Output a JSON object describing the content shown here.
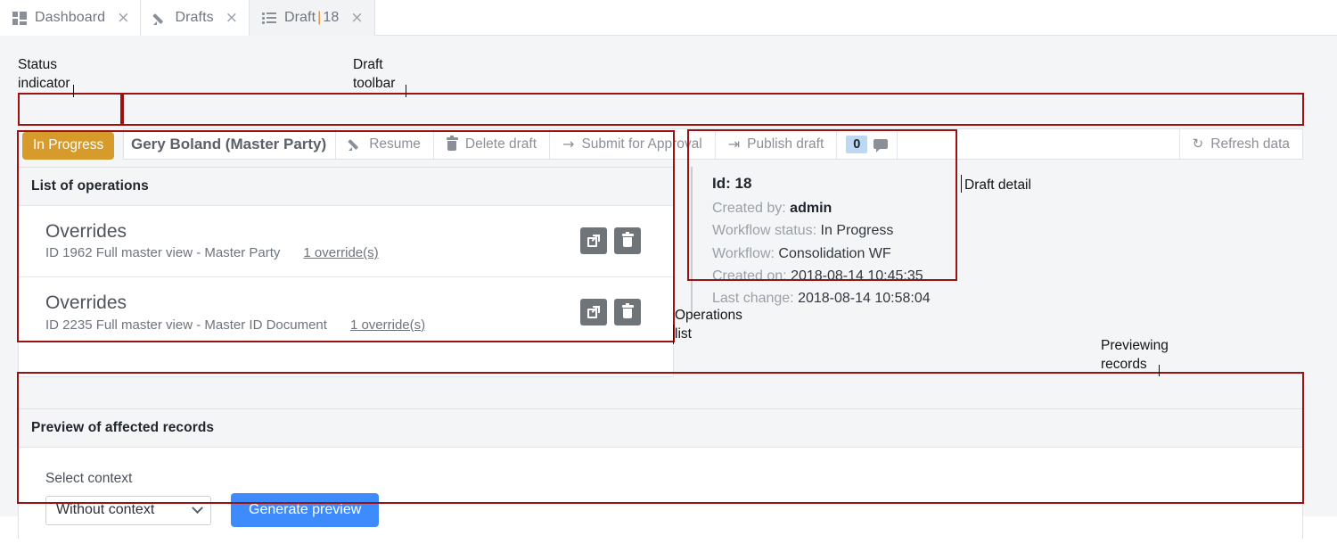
{
  "tabs": [
    {
      "label": "Dashboard",
      "icon": "dashboard-grid-icon",
      "close": "×",
      "active": false
    },
    {
      "label": "Drafts",
      "icon": "pencil-icon",
      "close": "×",
      "active": false
    },
    {
      "label": "Draft | 18",
      "label_main": "Draft",
      "label_sep": "|",
      "label_id": "18",
      "icon": "list-icon",
      "close": "×",
      "active": true
    }
  ],
  "toolbar": {
    "status_badge": "In Progress",
    "title": "Gery Boland (Master Party)",
    "resume_label": "Resume",
    "delete_label": "Delete draft",
    "submit_label": "Submit for Approval",
    "publish_label": "Publish draft",
    "comment_count": "0",
    "refresh_label": "Refresh data",
    "icons": {
      "resume": "pencil-icon",
      "delete": "trash-icon",
      "submit": "arrow-right-icon",
      "publish": "arrow-to-bar-icon",
      "comment": "speech-bubble-icon",
      "refresh": "refresh-icon"
    },
    "submit_arrow": "→",
    "publish_arrow": "⇥",
    "refresh_arrow": "↻"
  },
  "operations": {
    "header": "List of operations",
    "rows": [
      {
        "title": "Overrides",
        "subtitle": "ID 1962 Full master view - Master Party",
        "link": "1 override(s)",
        "open_icon": "external-link-icon",
        "delete_icon": "trash-icon"
      },
      {
        "title": "Overrides",
        "subtitle": "ID 2235 Full master view - Master ID Document",
        "link": "1 override(s)",
        "open_icon": "external-link-icon",
        "delete_icon": "trash-icon"
      }
    ]
  },
  "detail": {
    "id_label": "Id:",
    "id_value": "18",
    "rows": [
      {
        "label": "Created by:",
        "value": "admin",
        "bold": true
      },
      {
        "label": "Workflow status:",
        "value": "In Progress",
        "bold": false
      },
      {
        "label": "Workflow:",
        "value": "Consolidation WF",
        "bold": false
      },
      {
        "label": "Created on:",
        "value": "2018-08-14 10:45:35",
        "bold": false
      },
      {
        "label": "Last change:",
        "value": "2018-08-14 10:58:04",
        "bold": false
      }
    ]
  },
  "preview": {
    "header": "Preview of affected records",
    "select_label": "Select context",
    "select_value": "Without context",
    "button_label": "Generate preview"
  },
  "annotations": [
    {
      "key": "status",
      "text": "Status\nindicator"
    },
    {
      "key": "toolbar",
      "text": "Draft\ntoolbar"
    },
    {
      "key": "detail",
      "text": "Draft detail"
    },
    {
      "key": "ops",
      "text": "Operations\nlist"
    },
    {
      "key": "preview",
      "text": "Previewing\nrecords"
    }
  ],
  "colors": {
    "accent_red": "#9c1111",
    "status_amber": "#d79b2c",
    "primary_blue": "#3d8bfd",
    "badge_blue": "#bcd8f2",
    "tab_orange": "#e08a2e"
  }
}
